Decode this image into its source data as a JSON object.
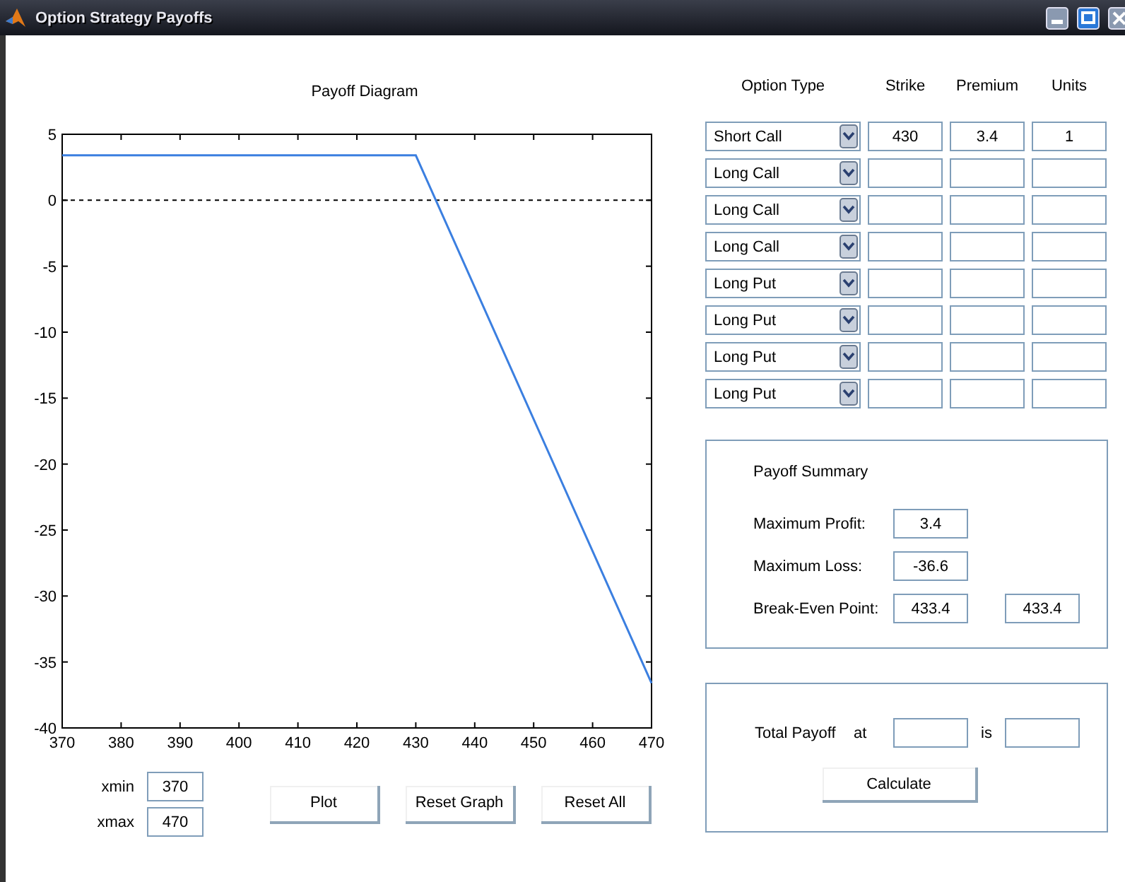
{
  "window": {
    "title": "Option Strategy Payoffs"
  },
  "payoff_diagram": {
    "chart_data": {
      "type": "line",
      "title": "Payoff Diagram",
      "x": [
        370,
        430,
        470
      ],
      "series": [
        {
          "color": "#3b7fe0",
          "values": [
            3.4,
            3.4,
            -36.6
          ]
        }
      ],
      "xlim": [
        370,
        470
      ],
      "ylim": [
        -40,
        5
      ],
      "xticks": [
        370,
        380,
        390,
        400,
        410,
        420,
        430,
        440,
        450,
        460,
        470
      ],
      "yticks": [
        5,
        0,
        -5,
        -10,
        -15,
        -20,
        -25,
        -30,
        -35,
        -40
      ]
    }
  },
  "range": [
    {
      "label": "xmin",
      "value": "370"
    },
    {
      "label": "xmax",
      "value": "470"
    }
  ],
  "buttons": [
    "Plot",
    "Reset Graph",
    "Reset All"
  ],
  "legs": {
    "columns": [
      "Option Type",
      "Strike",
      "Premium",
      "Units"
    ],
    "rows": [
      {
        "option_type": "Short Call",
        "strike": "430",
        "premium": "3.4",
        "units": "1"
      },
      {
        "option_type": "Long Call"
      },
      {
        "option_type": "Long Call"
      },
      {
        "option_type": "Long Call"
      },
      {
        "option_type": "Long Put"
      },
      {
        "option_type": "Long Put"
      },
      {
        "option_type": "Long Put"
      },
      {
        "option_type": "Long Put"
      }
    ]
  },
  "summary": {
    "title": "Payoff Summary",
    "rows": [
      {
        "label": "Maximum Profit:",
        "values": [
          "3.4"
        ]
      },
      {
        "label": "Maximum Loss:",
        "values": [
          "-36.6"
        ]
      },
      {
        "label": "Break-Even Point:",
        "values": [
          "433.4",
          "433.4"
        ]
      }
    ]
  },
  "total": {
    "label": "Total Payoff",
    "at": "at",
    "is": "is",
    "button": "Calculate"
  }
}
